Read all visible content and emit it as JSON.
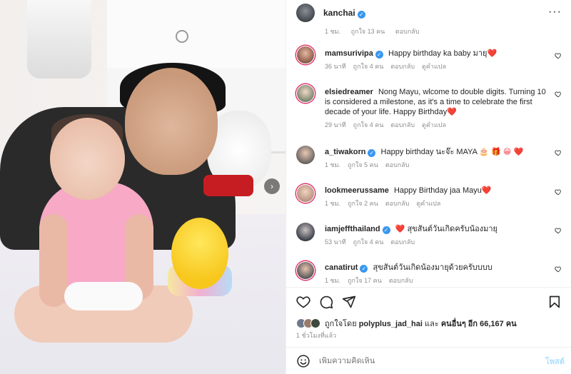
{
  "post": {
    "author": "kanchai",
    "verified": true
  },
  "clipped_meta": {
    "time": "1 ชม.",
    "likes": "ถูกใจ 13 คน",
    "reply": "ตอบกลับ"
  },
  "comments": [
    {
      "user": "mamsurivipa",
      "verified": true,
      "text": "Happy birthday ka baby มายุ",
      "emoji": "❤️",
      "time": "36 นาที",
      "likes": "ถูกใจ 4 คน",
      "reply": "ตอบกลับ",
      "translate": "ดูคำแปล"
    },
    {
      "user": "elsiedreamer",
      "verified": false,
      "text": "Nong Mayu, wlcome to double digits. Turning 10 is considered a milestone, as it's a time to celebrate the first decade of your life. Happy Birthday",
      "emoji": "❤️",
      "time": "29 นาที",
      "likes": "ถูกใจ 4 คน",
      "reply": "ตอบกลับ",
      "translate": "ดูคำแปล"
    },
    {
      "user": "a_tiwakorn",
      "verified": true,
      "text": "Happy birthday นะจ๊ะ MAYA",
      "emoji": "🎂 🎁 😁 ❤️",
      "time": "1 ชม.",
      "likes": "ถูกใจ 5 คน",
      "reply": "ตอบกลับ",
      "translate": ""
    },
    {
      "user": "lookmeerussame",
      "verified": false,
      "text": "Happy Birthday jaa Mayu",
      "emoji": "❤️",
      "time": "1 ชม.",
      "likes": "ถูกใจ 2 คน",
      "reply": "ตอบกลับ",
      "translate": "ดูคำแปล"
    },
    {
      "user": "iamjeffthailand",
      "verified": true,
      "text": "สุขสันต์วันเกิดครับน้องมายุ",
      "emoji": "❤️",
      "time": "53 นาที",
      "likes": "ถูกใจ 4 คน",
      "reply": "ตอบกลับ",
      "translate": ""
    },
    {
      "user": "canatirut",
      "verified": true,
      "text": "สุขสันต์วันเกิดน้องมายุด้วยครับบบบ",
      "emoji": "",
      "time": "1 ชม.",
      "likes": "ถูกใจ 17 คน",
      "reply": "ตอบกลับ",
      "translate": ""
    }
  ],
  "likes_summary": {
    "prefix": "ถูกใจโดย",
    "user": "polyplus_jad_hai",
    "middle": "และ",
    "others": "คนอื่นๆ อีก 66,167 คน"
  },
  "time_ago": "1 ชั่วโมงที่แล้ว",
  "add_comment": {
    "placeholder": "เพิ่มความคิดเห็น",
    "post_label": "โพสต์"
  },
  "icons": {
    "like": "heart-icon",
    "comment": "comment-icon",
    "share": "share-icon",
    "save": "bookmark-icon",
    "emoji": "emoji-icon",
    "more": "more-icon",
    "next": "chevron-right-icon"
  },
  "colors": {
    "verified": "#3897f0",
    "heart": "#ed4956",
    "link_disabled": "#b2dffc",
    "muted": "#8e8e8e"
  }
}
